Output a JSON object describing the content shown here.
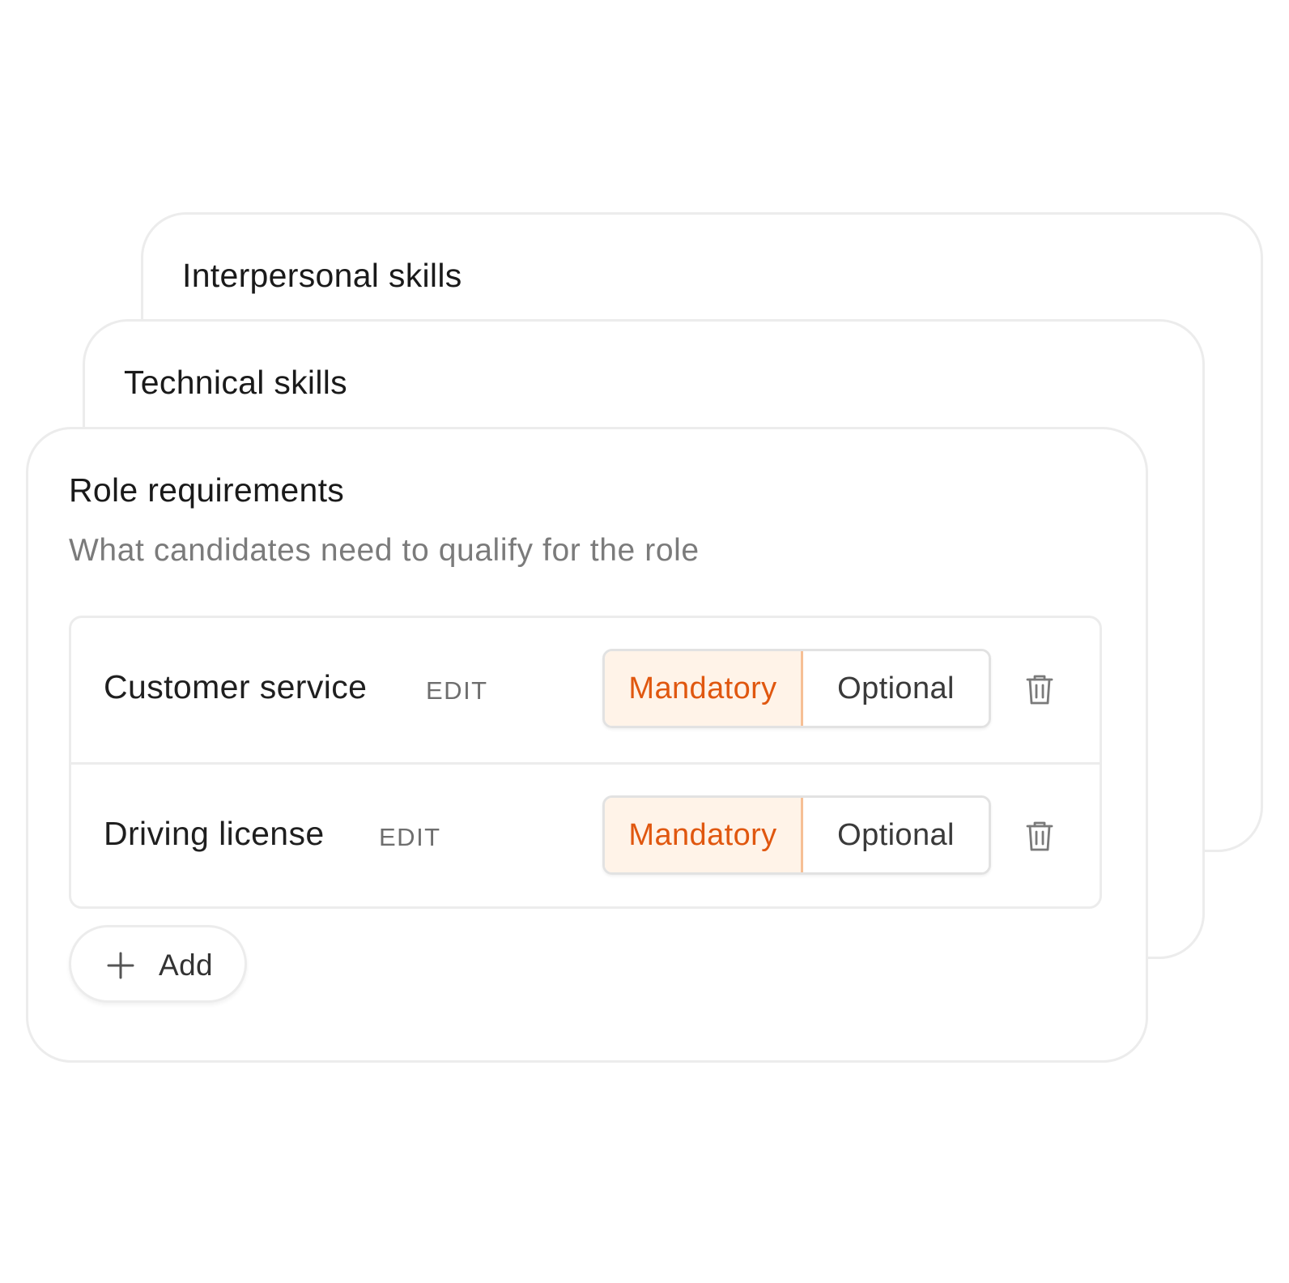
{
  "cards": {
    "back": {
      "title": "Interpersonal skills"
    },
    "middle": {
      "title": "Technical skills"
    },
    "front": {
      "title": "Role requirements",
      "subtitle": "What candidates need to qualify for the role",
      "requirements": [
        {
          "name": "Customer service",
          "edit_label": "EDIT",
          "mandatory_label": "Mandatory",
          "optional_label": "Optional",
          "selected": "Mandatory",
          "delete_icon": "trash-icon"
        },
        {
          "name": "Driving license",
          "edit_label": "EDIT",
          "mandatory_label": "Mandatory",
          "optional_label": "Optional",
          "selected": "Mandatory",
          "delete_icon": "trash-icon"
        }
      ],
      "add_button": {
        "label": "Add",
        "icon": "plus-icon"
      }
    }
  },
  "colors": {
    "accent": "#e0570f",
    "accent_bg": "#fff3e8",
    "accent_border": "#f6bf95",
    "border": "#ececec",
    "muted_text": "#7b7b7b"
  }
}
